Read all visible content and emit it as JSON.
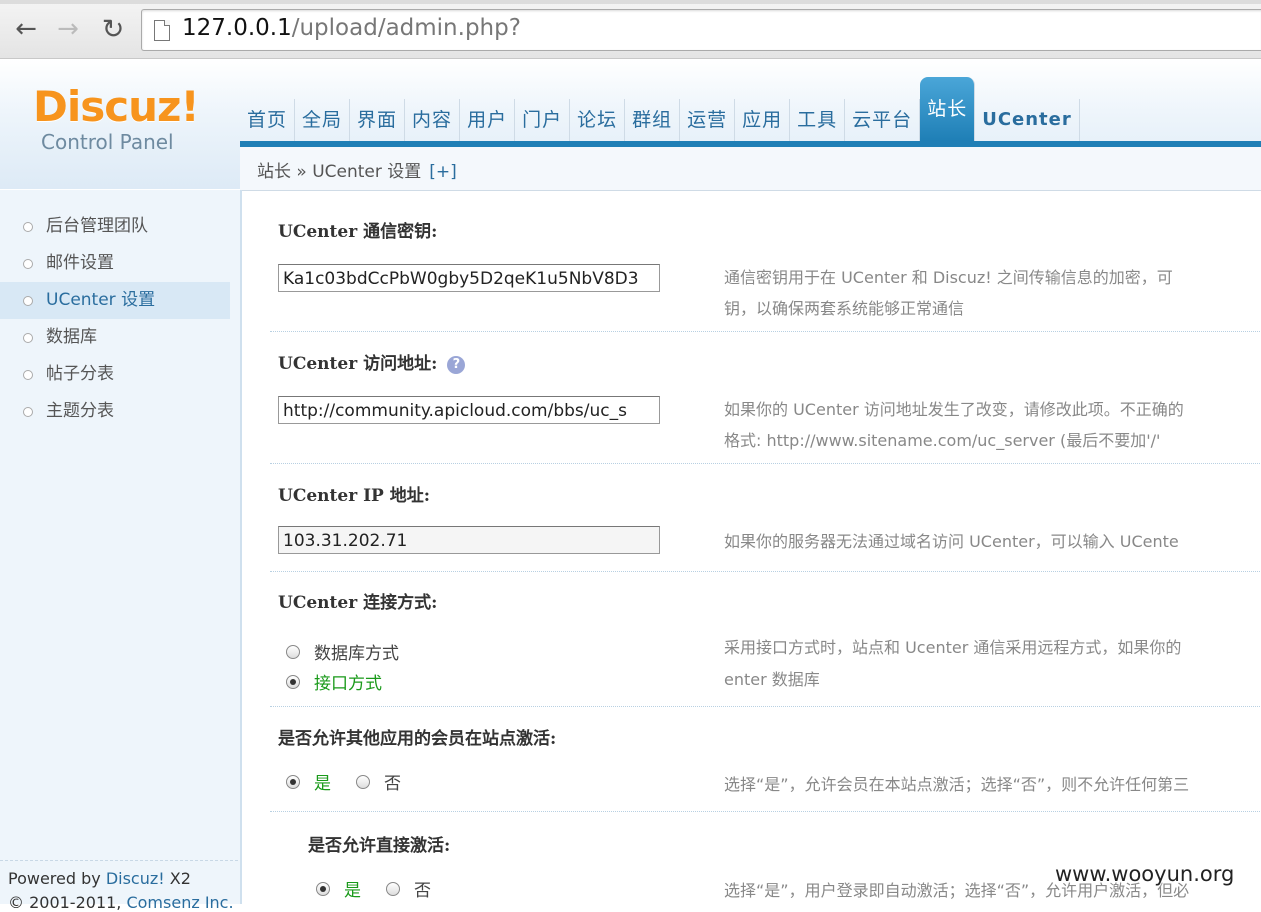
{
  "browser": {
    "url_host": "127.0.0.1",
    "url_path": "/upload/admin.php?"
  },
  "logo": {
    "brand": "Discuz!",
    "subtitle": "Control Panel"
  },
  "topnav": [
    "首页",
    "全局",
    "界面",
    "内容",
    "用户",
    "门户",
    "论坛",
    "群组",
    "运营",
    "应用",
    "工具",
    "云平台",
    "站长",
    "UCenter"
  ],
  "topnav_active": "站长",
  "breadcrumb": {
    "text": "站长 » UCenter 设置",
    "plus": "[+]"
  },
  "sidebar": {
    "items": [
      "后台管理团队",
      "邮件设置",
      "UCenter 设置",
      "数据库",
      "帖子分表",
      "主题分表"
    ],
    "active": "UCenter 设置",
    "powered_prefix": "Powered by ",
    "powered_link": "Discuz!",
    "powered_suffix": " X2",
    "copyright_prefix": "© 2001-2011, ",
    "copyright_link": "Comsenz Inc."
  },
  "form": {
    "key_label": "UCenter 通信密钥:",
    "key_value": "Ka1c03bdCcPbW0gby5D2qeK1u5NbV8D3",
    "key_desc_1": "通信密钥用于在 UCenter 和 Discuz! 之间传输信息的加密，可",
    "key_desc_2": "钥，以确保两套系统能够正常通信",
    "url_label": "UCenter 访问地址:",
    "url_help": "?",
    "url_value": "http://community.apicloud.com/bbs/uc_s",
    "url_desc_1": "如果你的 UCenter 访问地址发生了改变，请修改此项。不正确的",
    "url_desc_2": "格式: http://www.sitename.com/uc_server (最后不要加'/'",
    "ip_label": "UCenter IP 地址:",
    "ip_value": "103.31.202.71",
    "ip_desc": "如果你的服务器无法通过域名访问 UCenter，可以输入 UCente",
    "conn_label": "UCenter 连接方式:",
    "conn_opt1": "数据库方式",
    "conn_opt2": "接口方式",
    "conn_desc_1": "采用接口方式时，站点和 Ucenter 通信采用远程方式，如果你的",
    "conn_desc_2": "enter 数据库",
    "activate_label": "是否允许其他应用的会员在站点激活:",
    "yes": "是",
    "no": "否",
    "activate_desc": "选择“是”，允许会员在本站点激活；选择“否”，则不允许任何第三",
    "direct_label": "是否允许直接激活:",
    "direct_desc": "选择“是”，用户登录即自动激活；选择“否”，允许用户激活，但必"
  },
  "watermark": "www.wooyun.org"
}
